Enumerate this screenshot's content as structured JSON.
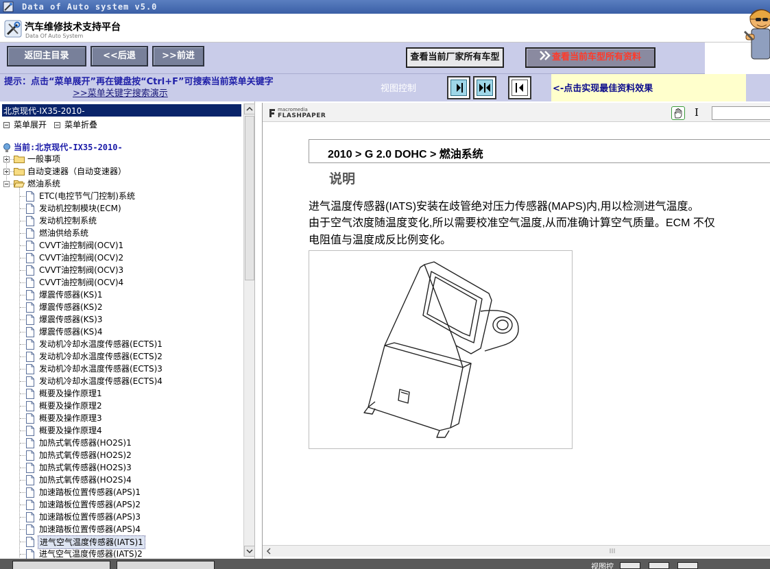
{
  "window": {
    "title": "Data of Auto system v5.0"
  },
  "brand": {
    "name_cn": "汽车维修技术支持平台",
    "name_en": "Data Of Auto System"
  },
  "toolbar": {
    "home_label": "返回主目录",
    "back_label": "<<后退",
    "forward_label": ">>前进",
    "maker_models_label": "查看当前厂家所有车型",
    "all_data_label": "查看当前车型所有资料",
    "all_data_color": "#ff3a2a"
  },
  "hint": {
    "text": "提示：点击“菜单展开”再在键盘按“Ctrl+F”可搜索当前菜单关键字",
    "demo_link": ">>菜单关键字搜索演示"
  },
  "view_control": {
    "label": "视图控制",
    "buttons": [
      "expand-right",
      "split",
      "collapse-left"
    ],
    "message": "<-点击实现最佳资料效果",
    "message_bg": "#ffffcc"
  },
  "tree": {
    "header": "北京现代-IX35-2010-",
    "expand_all_label": "菜单展开",
    "collapse_all_label": "菜单折叠",
    "current_label": "当前:北京现代-IX35-2010-",
    "folders": [
      {
        "label": "一般事项",
        "expanded": false
      },
      {
        "label": "自动变速器（自动变速器）",
        "expanded": false
      },
      {
        "label": "燃油系统",
        "expanded": true
      }
    ],
    "leaves": [
      "ETC(电控节气门控制)系统",
      "发动机控制模块(ECM)",
      "发动机控制系统",
      "燃油供给系统",
      "CVVT油控制阀(OCV)1",
      "CVVT油控制阀(OCV)2",
      "CVVT油控制阀(OCV)3",
      "CVVT油控制阀(OCV)4",
      "爆震传感器(KS)1",
      "爆震传感器(KS)2",
      "爆震传感器(KS)3",
      "爆震传感器(KS)4",
      "发动机冷却水温度传感器(ECTS)1",
      "发动机冷却水温度传感器(ECTS)2",
      "发动机冷却水温度传感器(ECTS)3",
      "发动机冷却水温度传感器(ECTS)4",
      "概要及操作原理1",
      "概要及操作原理2",
      "概要及操作原理3",
      "概要及操作原理4",
      "加热式氧传感器(HO2S)1",
      "加热式氧传感器(HO2S)2",
      "加热式氧传感器(HO2S)3",
      "加热式氧传感器(HO2S)4",
      "加速踏板位置传感器(APS)1",
      "加速踏板位置传感器(APS)2",
      "加速踏板位置传感器(APS)3",
      "加速踏板位置传感器(APS)4",
      "进气空气温度传感器(IATS)1",
      "进气空气温度传感器(IATS)2"
    ],
    "selected_leaf": "进气空气温度传感器(IATS)1",
    "selected_color": "#dde4f2"
  },
  "viewer": {
    "brand_small": "macromedia",
    "brand_name": "FLASHPAPER",
    "doc": {
      "breadcrumb": "2010 > G 2.0 DOHC > 燃油系统",
      "section_title": "说明",
      "paragraph_lines": [
        "进气温度传感器(IATS)安装在歧管绝对压力传感器(MAPS)内,用以检测进气温度。",
        "由于空气浓度随温度变化,所以需要校准空气温度,从而准确计算空气质量。ECM 不仅",
        "电阻值与温度成反比例变化。"
      ],
      "figure": "sensor-illustration"
    }
  },
  "statusbar": {
    "view_label": "视图控"
  }
}
